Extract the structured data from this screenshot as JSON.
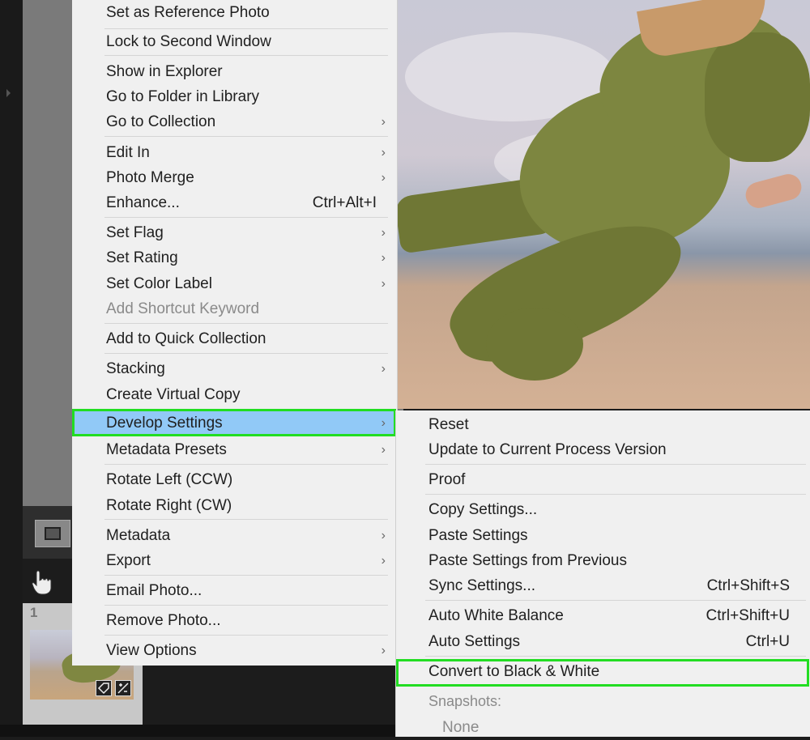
{
  "context_menu": {
    "items": [
      {
        "label": "Set as Reference Photo"
      },
      {
        "label": "Lock to Second Window"
      },
      {
        "label": "Show in Explorer"
      },
      {
        "label": "Go to Folder in Library"
      },
      {
        "label": "Go to Collection",
        "submenu": true
      },
      {
        "label": "Edit In",
        "submenu": true
      },
      {
        "label": "Photo Merge",
        "submenu": true
      },
      {
        "label": "Enhance...",
        "shortcut": "Ctrl+Alt+I"
      },
      {
        "label": "Set Flag",
        "submenu": true
      },
      {
        "label": "Set Rating",
        "submenu": true
      },
      {
        "label": "Set Color Label",
        "submenu": true
      },
      {
        "label": "Add Shortcut Keyword",
        "disabled": true
      },
      {
        "label": "Add to Quick Collection"
      },
      {
        "label": "Stacking",
        "submenu": true
      },
      {
        "label": "Create Virtual Copy"
      },
      {
        "label": "Develop Settings",
        "submenu": true,
        "highlighted": true
      },
      {
        "label": "Metadata Presets",
        "submenu": true
      },
      {
        "label": "Rotate Left (CCW)"
      },
      {
        "label": "Rotate Right (CW)"
      },
      {
        "label": "Metadata",
        "submenu": true
      },
      {
        "label": "Export",
        "submenu": true
      },
      {
        "label": "Email Photo..."
      },
      {
        "label": "Remove Photo..."
      },
      {
        "label": "View Options",
        "submenu": true
      }
    ]
  },
  "develop_submenu": {
    "items": [
      {
        "label": "Reset"
      },
      {
        "label": "Update to Current Process Version"
      },
      {
        "label": "Proof"
      },
      {
        "label": "Copy Settings..."
      },
      {
        "label": "Paste Settings"
      },
      {
        "label": "Paste Settings from Previous"
      },
      {
        "label": "Sync Settings...",
        "shortcut": "Ctrl+Shift+S"
      },
      {
        "label": "Auto White Balance",
        "shortcut": "Ctrl+Shift+U"
      },
      {
        "label": "Auto Settings",
        "shortcut": "Ctrl+U"
      },
      {
        "label": "Convert to Black & White",
        "outlined": true
      },
      {
        "label": "Snapshots:",
        "disabled": true
      },
      {
        "label": "None",
        "disabled": true
      }
    ]
  },
  "filmstrip": {
    "frame_number": "1"
  },
  "colors": {
    "menu_bg": "#f0f0f0",
    "highlight": "#91c9f7",
    "callout_outline": "#22dd22",
    "disabled_text": "#8a8a8a"
  },
  "icons": {
    "submenu_arrow": "chevron-right-icon",
    "hand_tool": "hand-icon",
    "loupe_view": "loupe-view-icon"
  }
}
